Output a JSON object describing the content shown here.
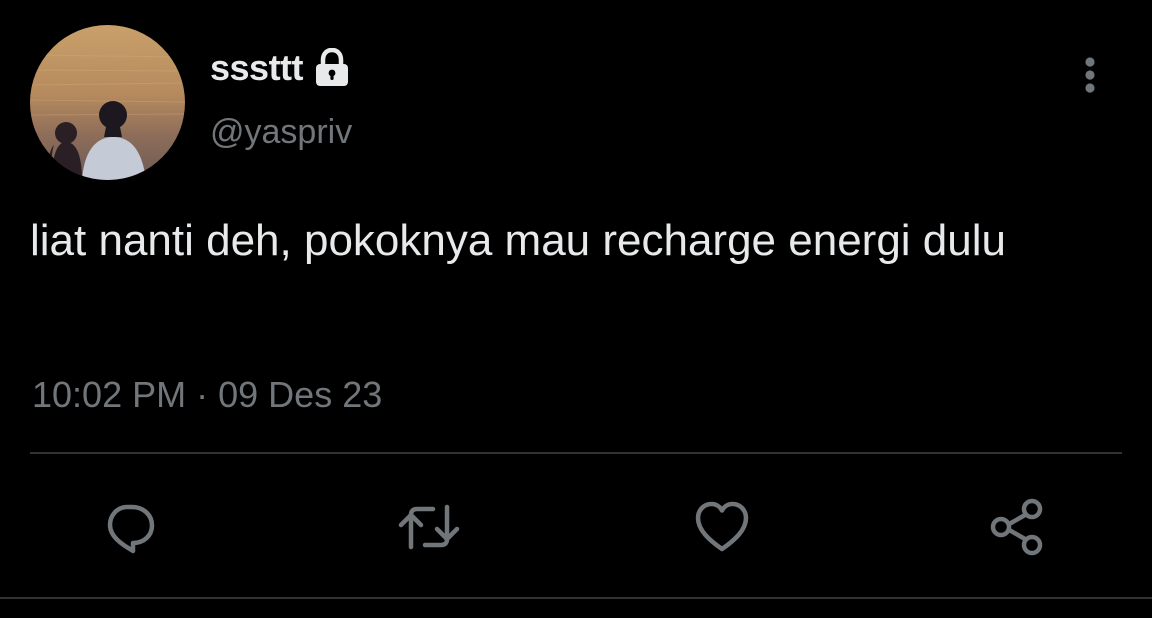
{
  "user": {
    "display_name": "sssttt",
    "handle": "@yaspriv",
    "avatar_icon": "avatar-couple-sunset-photo",
    "lock_icon": "lock-icon"
  },
  "tweet": {
    "text": "liat nanti deh, pokoknya mau recharge energi dulu",
    "time": "10:02 PM",
    "separator": "·",
    "date": "09 Des 23"
  },
  "actions": [
    {
      "name": "reply",
      "icon": "comment-icon"
    },
    {
      "name": "retweet",
      "icon": "retweet-icon"
    },
    {
      "name": "like",
      "icon": "heart-icon"
    },
    {
      "name": "share",
      "icon": "share-icon"
    }
  ],
  "colors": {
    "background": "#000000",
    "primary_text": "#e7e9ea",
    "secondary_text": "#71767b",
    "icon": "#71767b",
    "divider": "#2f3336"
  }
}
